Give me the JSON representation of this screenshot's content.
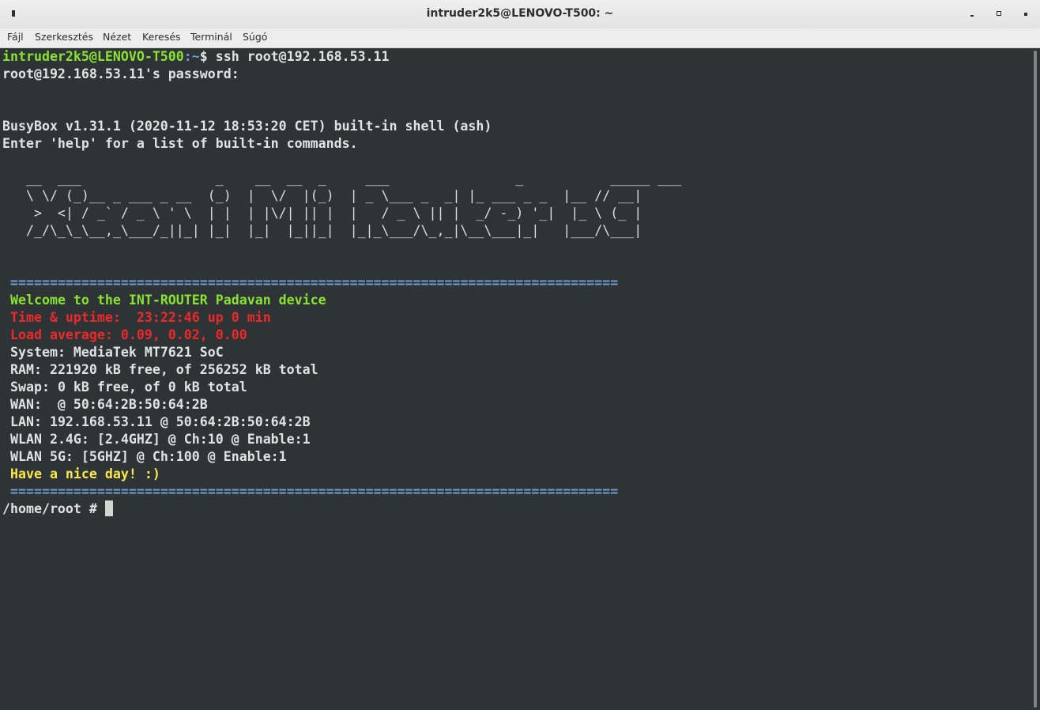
{
  "window": {
    "title": "intruder2k5@LENOVO-T500: ~"
  },
  "menubar": {
    "items": [
      "Fájl",
      "Szerkesztés",
      "Nézet",
      "Keresés",
      "Terminál",
      "Súgó"
    ]
  },
  "terminal": {
    "prompt_user": "intruder2k5@LENOVO-T500",
    "prompt_path": ":~",
    "prompt_cmd": "$ ssh root@192.168.53.11",
    "password_line": "root@192.168.53.11's password:",
    "busybox_line": "BusyBox v1.31.1 (2020-11-12 18:53:20 CET) built-in shell (ash)",
    "help_line": "Enter 'help' for a list of built-in commands.",
    "ascii_art": [
      "   __  ___                 _    __  __  _     ___                _           _____ ___",
      "   \\ \\/ (_)__ _ ___ _ __  (_)  |  \\/  |(_)  | _ \\___ _  _| |_ ___ _ _  |__ // __|",
      "    >  <| / _` / _ \\ ' \\  | |  | |\\/| || |  |   / _ \\ || |  _/ -_) '_|  |_ \\ (_ |",
      "   /_/\\_\\_\\__,_\\___/_||_| |_|  |_|  |_||_|  |_|_\\___/\\_,_|\\__\\___|_|   |___/\\___|"
    ],
    "separator": "=============================================================================",
    "welcome": "Welcome to the INT-ROUTER Padavan device",
    "uptime": "Time & uptime:  23:22:46 up 0 min",
    "load": "Load average: 0.09, 0.02, 0.00",
    "system": "System: MediaTek MT7621 SoC",
    "ram": "RAM: 221920 kB free, of 256252 kB total",
    "swap": "Swap: 0 kB free, of 0 kB total",
    "wan": "WAN:  @ 50:64:2B:50:64:2B",
    "lan": "LAN: 192.168.53.11 @ 50:64:2B:50:64:2B",
    "wlan24": "WLAN 2.4G: [2.4GHZ] @ Ch:10 @ Enable:1",
    "wlan5": "WLAN 5G: [5GHZ] @ Ch:100 @ Enable:1",
    "nice_day": "Have a nice day! :)",
    "root_prompt": "/home/root # "
  }
}
